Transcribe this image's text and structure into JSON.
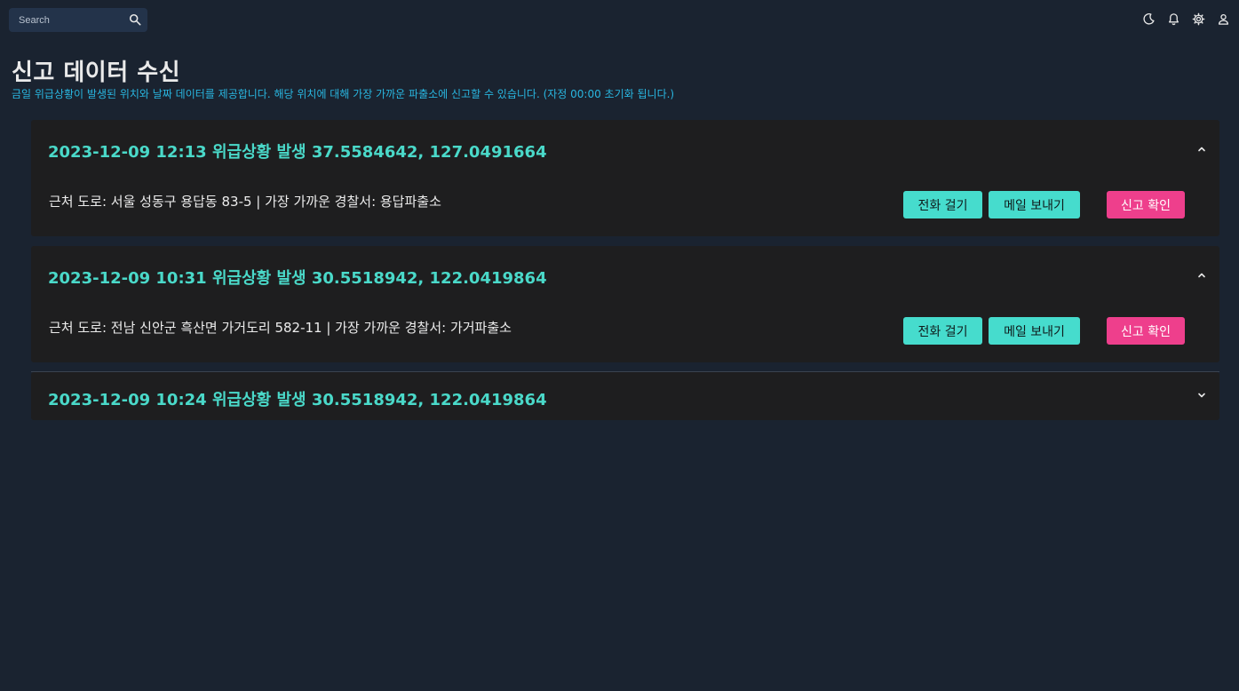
{
  "topbar": {
    "search_placeholder": "Search",
    "icons": [
      "search-icon",
      "moon-icon",
      "bell-icon",
      "gear-icon",
      "user-icon"
    ]
  },
  "page": {
    "title": "신고 데이터 수신",
    "subtitle": "금일 위급상황이 발생된 위치와 날짜 데이터를 제공합니다. 해당 위치에 대해 가장 가까운 파출소에 신고할 수 있습니다. (자정 00:00 초기화 됩니다.)"
  },
  "reports": [
    {
      "title": "2023-12-09 12:13 위급상황 발생 37.5584642, 127.0491664",
      "expanded": true,
      "detail": "근처 도로: 서울 성동구 용답동 83-5 | 가장 가까운 경찰서: 용답파출소",
      "call_label": "전화 걸기",
      "mail_label": "메일 보내기",
      "confirm_label": "신고 확인"
    },
    {
      "title": "2023-12-09 10:31 위급상황 발생 30.5518942, 122.0419864",
      "expanded": true,
      "detail": "근처 도로: 전남 신안군 흑산면 가거도리 582-11 | 가장 가까운 경찰서: 가거파출소",
      "call_label": "전화 걸기",
      "mail_label": "메일 보내기",
      "confirm_label": "신고 확인"
    },
    {
      "title": "2023-12-09 10:24 위급상황 발생 30.5518942, 122.0419864",
      "expanded": false
    }
  ],
  "colors": {
    "background": "#1a2330",
    "card": "#1e1e1f",
    "accent": "#4ad9c9",
    "button_teal": "#46dccd",
    "button_pink": "#ee3f8c",
    "subtitle": "#29b6e0"
  }
}
